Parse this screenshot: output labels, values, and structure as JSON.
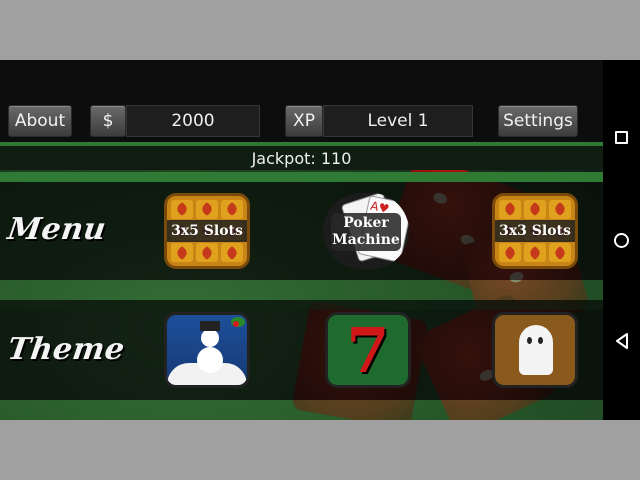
{
  "topbar": {
    "about_label": "About",
    "currency_label": "$",
    "balance": "2000",
    "xp_label": "XP",
    "level": "Level 1",
    "settings_label": "Settings"
  },
  "jackpot": {
    "text": "Jackpot: 110"
  },
  "menu_row": {
    "label": "Menu",
    "items": [
      {
        "label": "3x5 Slots",
        "icon": "slot-reels-icon"
      },
      {
        "label": "Poker Machine",
        "line1": "Poker",
        "line2": "Machine",
        "icon": "playing-cards-icon"
      },
      {
        "label": "3x3 Slots",
        "icon": "slot-reels-icon"
      }
    ]
  },
  "theme_row": {
    "label": "Theme",
    "items": [
      {
        "icon": "snowman-christmas-icon"
      },
      {
        "icon": "lucky-seven-icon",
        "glyph": "7"
      },
      {
        "icon": "ghost-icon"
      }
    ]
  },
  "colors": {
    "accent_green": "#2f7b33",
    "tile_orange": "#c98416",
    "dice_red": "#d21c1c"
  },
  "navbar": {
    "icons": [
      "recent-apps-icon",
      "home-icon",
      "back-icon"
    ]
  }
}
